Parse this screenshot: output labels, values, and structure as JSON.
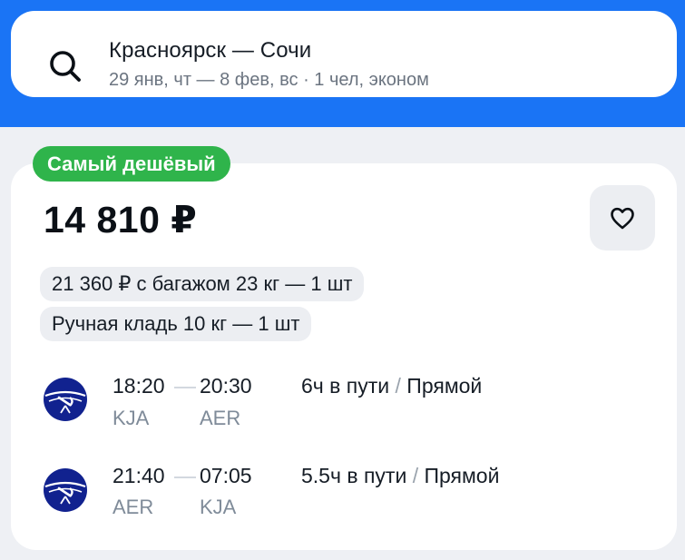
{
  "search": {
    "route": "Красноярск — Сочи",
    "details": "29 янв, чт — 8 фев, вс · 1 чел, эконом"
  },
  "offer": {
    "badge": "Самый дешёвый",
    "price": "14 810 ₽",
    "chips": [
      "21 360 ₽ с багажом 23 кг — 1 шт",
      "Ручная кладь 10 кг — 1 шт"
    ],
    "segments": [
      {
        "dep_time": "18:20",
        "arr_time": "20:30",
        "dep_code": "KJA",
        "arr_code": "AER",
        "duration": "6ч в пути",
        "sep": "/",
        "stops": "Прямой"
      },
      {
        "dep_time": "21:40",
        "arr_time": "07:05",
        "dep_code": "AER",
        "arr_code": "KJA",
        "duration": "5.5ч в пути",
        "sep": "/",
        "stops": "Прямой"
      }
    ]
  },
  "colors": {
    "header_blue": "#1a74f5",
    "badge_green": "#2fb44b",
    "airline_navy": "#11228f"
  },
  "icons": {
    "search": "search-icon",
    "favorite": "heart-outline-icon",
    "airline": "aeroflot-logo"
  }
}
